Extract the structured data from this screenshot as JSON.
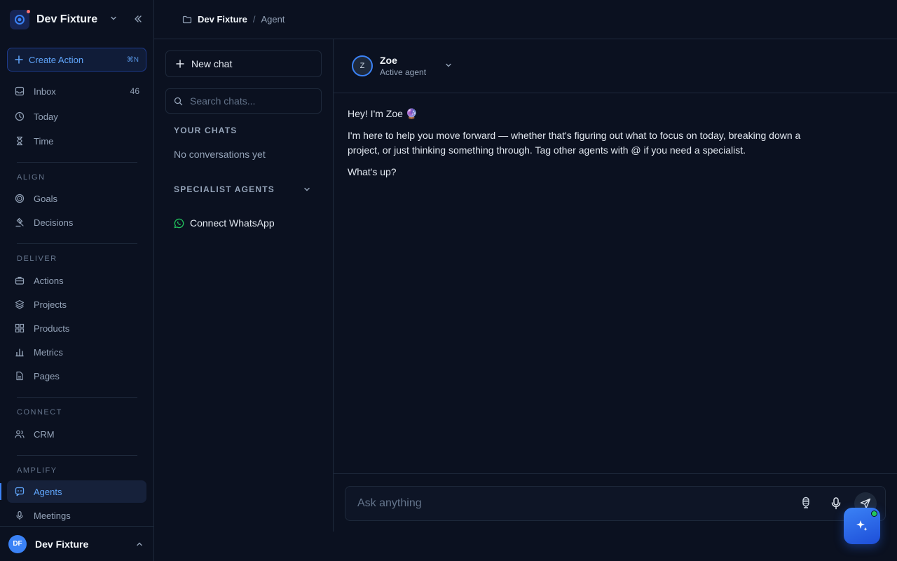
{
  "workspace": {
    "name": "Dev Fixture"
  },
  "create_action": {
    "label": "Create Action",
    "shortcut": "⌘N"
  },
  "nav": {
    "inbox": {
      "label": "Inbox",
      "count": "46"
    },
    "today": {
      "label": "Today"
    },
    "time": {
      "label": "Time"
    },
    "align_label": "ALIGN",
    "goals": {
      "label": "Goals"
    },
    "decisions": {
      "label": "Decisions"
    },
    "deliver_label": "DELIVER",
    "actions": {
      "label": "Actions"
    },
    "projects": {
      "label": "Projects"
    },
    "products": {
      "label": "Products"
    },
    "metrics": {
      "label": "Metrics"
    },
    "pages": {
      "label": "Pages"
    },
    "connect_label": "CONNECT",
    "crm": {
      "label": "CRM"
    },
    "amplify_label": "AMPLIFY",
    "agents": {
      "label": "Agents"
    },
    "meetings": {
      "label": "Meetings"
    }
  },
  "user": {
    "initials": "DF",
    "name": "Dev Fixture"
  },
  "breadcrumb": {
    "workspace": "Dev Fixture",
    "separator": "/",
    "page": "Agent"
  },
  "chat_panel": {
    "new_chat": "New chat",
    "search_placeholder": "Search chats...",
    "your_chats_label": "YOUR CHATS",
    "empty": "No conversations yet",
    "specialist_label": "SPECIALIST AGENTS",
    "whatsapp": "Connect WhatsApp"
  },
  "agent": {
    "initial": "Z",
    "name": "Zoe",
    "status": "Active agent"
  },
  "messages": [
    "Hey! I'm Zoe 🔮",
    "I'm here to help you move forward — whether that's figuring out what to focus on today, breaking down a project, or just thinking something through. Tag other agents with @ if you need a specialist.",
    "What's up?"
  ],
  "composer": {
    "placeholder": "Ask anything"
  },
  "colors": {
    "accent": "#3b82f6",
    "background": "#0b1120",
    "whatsapp": "#22c55e"
  }
}
